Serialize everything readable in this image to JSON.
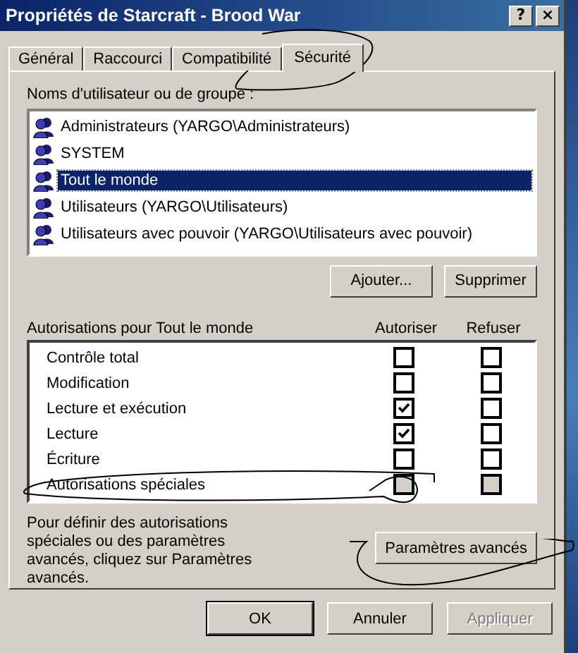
{
  "window": {
    "title": "Propriétés de Starcraft - Brood War",
    "title_buttons": [
      "?",
      "×"
    ]
  },
  "tabs": [
    {
      "label": "Général",
      "selected": false
    },
    {
      "label": "Raccourci",
      "selected": false
    },
    {
      "label": "Compatibilité",
      "selected": false
    },
    {
      "label": "Sécurité",
      "selected": true
    }
  ],
  "users": {
    "label": "Noms d'utilisateur ou de groupe :",
    "items": [
      {
        "name": "Administrateurs (YARGO\\Administrateurs)",
        "selected": false
      },
      {
        "name": "SYSTEM",
        "selected": false
      },
      {
        "name": "Tout le monde",
        "selected": true
      },
      {
        "name": "Utilisateurs (YARGO\\Utilisateurs)",
        "selected": false
      },
      {
        "name": "Utilisateurs avec pouvoir (YARGO\\Utilisateurs avec pouvoir)",
        "selected": false
      }
    ],
    "buttons": [
      "Ajouter...",
      "Supprimer"
    ]
  },
  "permissions": {
    "label": "Autorisations pour Tout le monde",
    "columns": [
      "Autoriser",
      "Refuser"
    ],
    "rows": [
      {
        "name": "Contrôle total",
        "allow": false,
        "deny": false,
        "disabled": false
      },
      {
        "name": "Modification",
        "allow": false,
        "deny": false,
        "disabled": false
      },
      {
        "name": "Lecture et exécution",
        "allow": true,
        "deny": false,
        "disabled": false
      },
      {
        "name": "Lecture",
        "allow": true,
        "deny": false,
        "disabled": false
      },
      {
        "name": "Écriture",
        "allow": false,
        "deny": false,
        "disabled": false
      },
      {
        "name": "Autorisations spéciales",
        "allow": false,
        "deny": false,
        "disabled": true
      }
    ]
  },
  "advanced": {
    "text": "Pour définir des autorisations spéciales ou des paramètres avancés, cliquez sur Paramètres avancés.",
    "button": "Paramètres avancés"
  },
  "footer": [
    {
      "label": "OK",
      "disabled": false,
      "default": true
    },
    {
      "label": "Annuler",
      "disabled": false,
      "default": false
    },
    {
      "label": "Appliquer",
      "disabled": true,
      "default": false
    }
  ]
}
